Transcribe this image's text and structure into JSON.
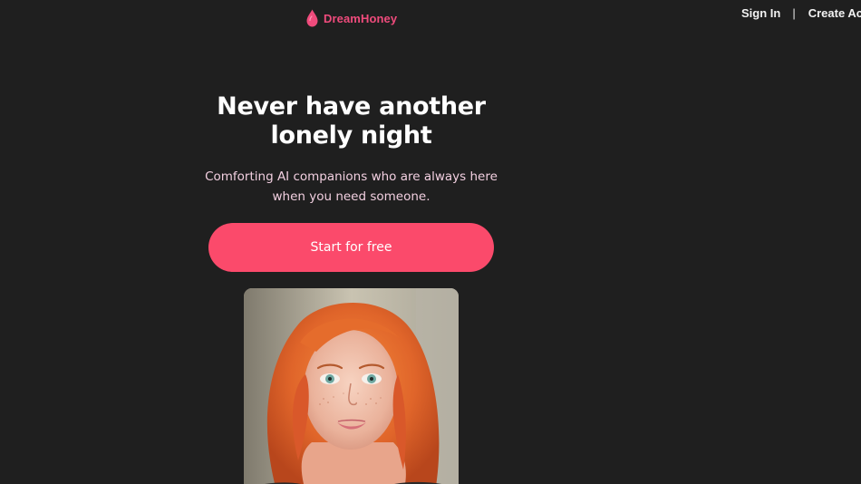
{
  "brand": {
    "name": "DreamHoney",
    "icon": "drop-icon",
    "color": "#ef4b7c"
  },
  "nav": {
    "sign_in": "Sign In",
    "separator": "|",
    "create_account": "Create Acco"
  },
  "hero": {
    "title_line1": "Never have another",
    "title_line2": "lonely night",
    "subtitle_line1": "Comforting AI companions who are always here",
    "subtitle_line2": "when you need someone.",
    "cta_label": "Start for free",
    "cta_color": "#fb4a6b"
  },
  "portrait": {
    "icon": "companion-portrait"
  },
  "colors": {
    "background": "#1f1f1f",
    "subtitle": "#f2cfe0"
  }
}
